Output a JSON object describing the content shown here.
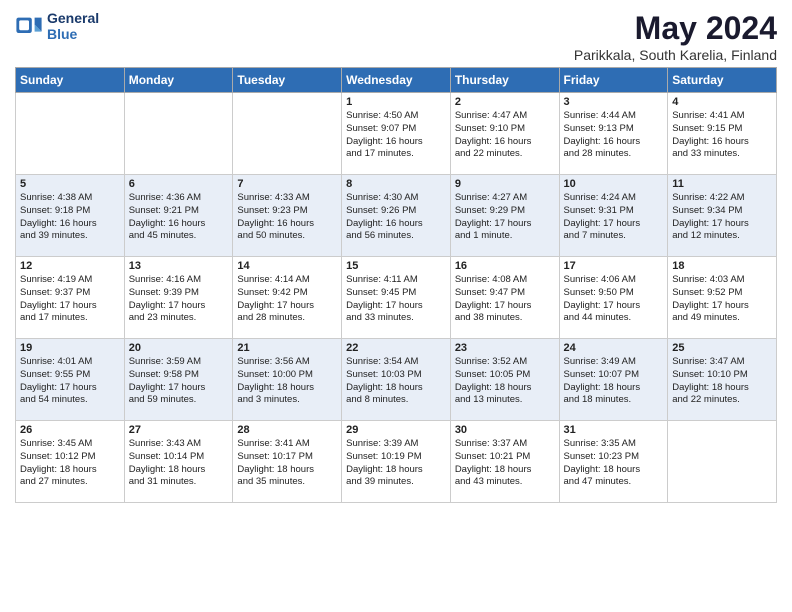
{
  "header": {
    "logo_line1": "General",
    "logo_line2": "Blue",
    "title": "May 2024",
    "subtitle": "Parikkala, South Karelia, Finland"
  },
  "columns": [
    "Sunday",
    "Monday",
    "Tuesday",
    "Wednesday",
    "Thursday",
    "Friday",
    "Saturday"
  ],
  "weeks": [
    {
      "days": [
        {
          "num": "",
          "info": ""
        },
        {
          "num": "",
          "info": ""
        },
        {
          "num": "",
          "info": ""
        },
        {
          "num": "1",
          "info": "Sunrise: 4:50 AM\nSunset: 9:07 PM\nDaylight: 16 hours\nand 17 minutes."
        },
        {
          "num": "2",
          "info": "Sunrise: 4:47 AM\nSunset: 9:10 PM\nDaylight: 16 hours\nand 22 minutes."
        },
        {
          "num": "3",
          "info": "Sunrise: 4:44 AM\nSunset: 9:13 PM\nDaylight: 16 hours\nand 28 minutes."
        },
        {
          "num": "4",
          "info": "Sunrise: 4:41 AM\nSunset: 9:15 PM\nDaylight: 16 hours\nand 33 minutes."
        }
      ]
    },
    {
      "days": [
        {
          "num": "5",
          "info": "Sunrise: 4:38 AM\nSunset: 9:18 PM\nDaylight: 16 hours\nand 39 minutes."
        },
        {
          "num": "6",
          "info": "Sunrise: 4:36 AM\nSunset: 9:21 PM\nDaylight: 16 hours\nand 45 minutes."
        },
        {
          "num": "7",
          "info": "Sunrise: 4:33 AM\nSunset: 9:23 PM\nDaylight: 16 hours\nand 50 minutes."
        },
        {
          "num": "8",
          "info": "Sunrise: 4:30 AM\nSunset: 9:26 PM\nDaylight: 16 hours\nand 56 minutes."
        },
        {
          "num": "9",
          "info": "Sunrise: 4:27 AM\nSunset: 9:29 PM\nDaylight: 17 hours\nand 1 minute."
        },
        {
          "num": "10",
          "info": "Sunrise: 4:24 AM\nSunset: 9:31 PM\nDaylight: 17 hours\nand 7 minutes."
        },
        {
          "num": "11",
          "info": "Sunrise: 4:22 AM\nSunset: 9:34 PM\nDaylight: 17 hours\nand 12 minutes."
        }
      ]
    },
    {
      "days": [
        {
          "num": "12",
          "info": "Sunrise: 4:19 AM\nSunset: 9:37 PM\nDaylight: 17 hours\nand 17 minutes."
        },
        {
          "num": "13",
          "info": "Sunrise: 4:16 AM\nSunset: 9:39 PM\nDaylight: 17 hours\nand 23 minutes."
        },
        {
          "num": "14",
          "info": "Sunrise: 4:14 AM\nSunset: 9:42 PM\nDaylight: 17 hours\nand 28 minutes."
        },
        {
          "num": "15",
          "info": "Sunrise: 4:11 AM\nSunset: 9:45 PM\nDaylight: 17 hours\nand 33 minutes."
        },
        {
          "num": "16",
          "info": "Sunrise: 4:08 AM\nSunset: 9:47 PM\nDaylight: 17 hours\nand 38 minutes."
        },
        {
          "num": "17",
          "info": "Sunrise: 4:06 AM\nSunset: 9:50 PM\nDaylight: 17 hours\nand 44 minutes."
        },
        {
          "num": "18",
          "info": "Sunrise: 4:03 AM\nSunset: 9:52 PM\nDaylight: 17 hours\nand 49 minutes."
        }
      ]
    },
    {
      "days": [
        {
          "num": "19",
          "info": "Sunrise: 4:01 AM\nSunset: 9:55 PM\nDaylight: 17 hours\nand 54 minutes."
        },
        {
          "num": "20",
          "info": "Sunrise: 3:59 AM\nSunset: 9:58 PM\nDaylight: 17 hours\nand 59 minutes."
        },
        {
          "num": "21",
          "info": "Sunrise: 3:56 AM\nSunset: 10:00 PM\nDaylight: 18 hours\nand 3 minutes."
        },
        {
          "num": "22",
          "info": "Sunrise: 3:54 AM\nSunset: 10:03 PM\nDaylight: 18 hours\nand 8 minutes."
        },
        {
          "num": "23",
          "info": "Sunrise: 3:52 AM\nSunset: 10:05 PM\nDaylight: 18 hours\nand 13 minutes."
        },
        {
          "num": "24",
          "info": "Sunrise: 3:49 AM\nSunset: 10:07 PM\nDaylight: 18 hours\nand 18 minutes."
        },
        {
          "num": "25",
          "info": "Sunrise: 3:47 AM\nSunset: 10:10 PM\nDaylight: 18 hours\nand 22 minutes."
        }
      ]
    },
    {
      "days": [
        {
          "num": "26",
          "info": "Sunrise: 3:45 AM\nSunset: 10:12 PM\nDaylight: 18 hours\nand 27 minutes."
        },
        {
          "num": "27",
          "info": "Sunrise: 3:43 AM\nSunset: 10:14 PM\nDaylight: 18 hours\nand 31 minutes."
        },
        {
          "num": "28",
          "info": "Sunrise: 3:41 AM\nSunset: 10:17 PM\nDaylight: 18 hours\nand 35 minutes."
        },
        {
          "num": "29",
          "info": "Sunrise: 3:39 AM\nSunset: 10:19 PM\nDaylight: 18 hours\nand 39 minutes."
        },
        {
          "num": "30",
          "info": "Sunrise: 3:37 AM\nSunset: 10:21 PM\nDaylight: 18 hours\nand 43 minutes."
        },
        {
          "num": "31",
          "info": "Sunrise: 3:35 AM\nSunset: 10:23 PM\nDaylight: 18 hours\nand 47 minutes."
        },
        {
          "num": "",
          "info": ""
        }
      ]
    }
  ]
}
